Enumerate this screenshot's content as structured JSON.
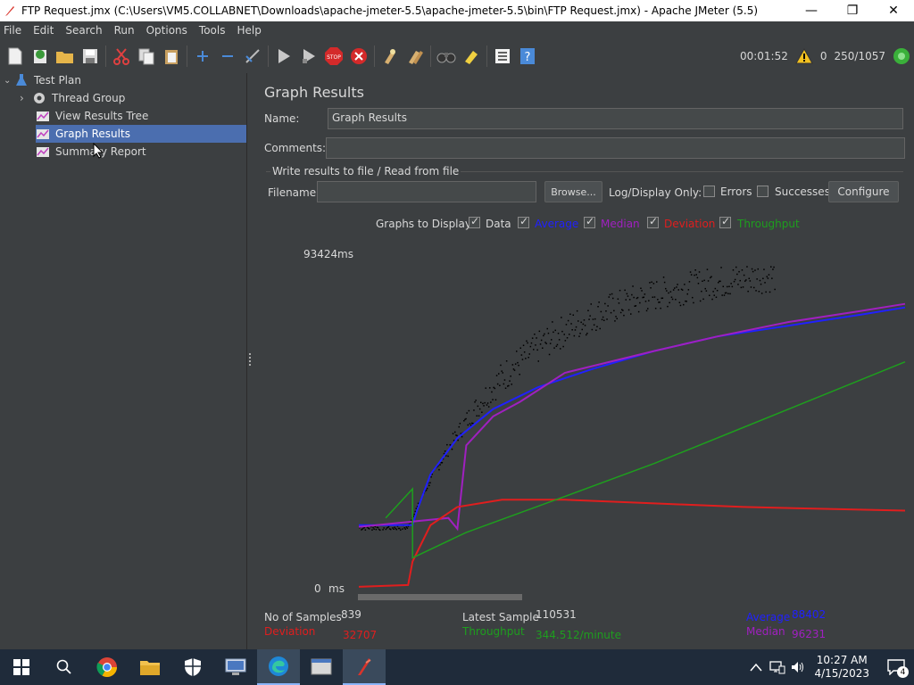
{
  "window": {
    "title": "FTP Request.jmx (C:\\Users\\VM5.COLLABNET\\Downloads\\apache-jmeter-5.5\\apache-jmeter-5.5\\bin\\FTP Request.jmx) - Apache JMeter (5.5)",
    "min": "—",
    "max": "❐",
    "close": "✕"
  },
  "menu": [
    "File",
    "Edit",
    "Search",
    "Run",
    "Options",
    "Tools",
    "Help"
  ],
  "toolbar": {
    "elapsed": "00:01:52",
    "warnings": "0",
    "threads": "250/1057"
  },
  "tree": {
    "items": [
      "Test Plan",
      "Thread Group",
      "View Results Tree",
      "Graph Results",
      "Summary Report"
    ]
  },
  "panel": {
    "title": "Graph Results",
    "name_label": "Name:",
    "name_value": "Graph Results",
    "comments_label": "Comments:",
    "comments_value": "",
    "file_section": "Write results to file / Read from file",
    "filename_label": "Filename",
    "filename_value": "",
    "browse": "Browse...",
    "log_display": "Log/Display Only:",
    "errors": "Errors",
    "successes": "Successes",
    "configure": "Configure",
    "graphs_to_display": "Graphs to Display",
    "legend": {
      "data": "Data",
      "average": "Average",
      "median": "Median",
      "deviation": "Deviation",
      "throughput": "Throughput"
    }
  },
  "colors": {
    "data": "#000000",
    "average": "#2020ff",
    "median": "#a020c0",
    "deviation": "#e01e1e",
    "throughput": "#1e9e1e"
  },
  "chart_data": {
    "type": "line",
    "y_max_label": "93424",
    "y_min_label": "0",
    "y_unit": "ms",
    "ylim": [
      0,
      93424
    ],
    "x_label": "",
    "series": [
      {
        "name": "Average",
        "values": [
          [
            0,
            18000
          ],
          [
            60,
            18000
          ],
          [
            65,
            22000
          ],
          [
            80,
            32000
          ],
          [
            110,
            42000
          ],
          [
            150,
            50000
          ],
          [
            200,
            56000
          ],
          [
            260,
            61000
          ],
          [
            330,
            66000
          ],
          [
            400,
            70000
          ],
          [
            480,
            73000
          ],
          [
            560,
            76000
          ],
          [
            610,
            78000
          ]
        ]
      },
      {
        "name": "Median",
        "values": [
          [
            0,
            17500
          ],
          [
            60,
            19000
          ],
          [
            100,
            20000
          ],
          [
            110,
            17000
          ],
          [
            120,
            40000
          ],
          [
            150,
            48000
          ],
          [
            180,
            52000
          ],
          [
            230,
            60000
          ],
          [
            330,
            66000
          ],
          [
            400,
            70000
          ],
          [
            480,
            74000
          ],
          [
            560,
            77000
          ],
          [
            610,
            79000
          ]
        ]
      },
      {
        "name": "Deviation",
        "values": [
          [
            0,
            1000
          ],
          [
            55,
            1500
          ],
          [
            60,
            8000
          ],
          [
            80,
            18000
          ],
          [
            110,
            23000
          ],
          [
            160,
            25000
          ],
          [
            230,
            25000
          ],
          [
            330,
            24000
          ],
          [
            430,
            23000
          ],
          [
            520,
            22500
          ],
          [
            610,
            22000
          ]
        ]
      },
      {
        "name": "Throughput",
        "values": [
          [
            30,
            20000
          ],
          [
            60,
            28000
          ],
          [
            60,
            9000
          ],
          [
            120,
            16000
          ],
          [
            220,
            25000
          ],
          [
            330,
            35000
          ],
          [
            430,
            45000
          ],
          [
            530,
            55000
          ],
          [
            610,
            63000
          ]
        ]
      }
    ]
  },
  "stats": {
    "samples_label": "No of Samples",
    "samples_value": "839",
    "latest_label": "Latest Sample",
    "latest_value": "110531",
    "average_label": "Average",
    "average_value": "88402",
    "deviation_label": "Deviation",
    "deviation_value": "32707",
    "throughput_label": "Throughput",
    "throughput_value": "344.512/minute",
    "median_label": "Median",
    "median_value": "96231"
  },
  "taskbar": {
    "time": "10:27 AM",
    "date": "4/15/2023",
    "notifications": "4"
  }
}
